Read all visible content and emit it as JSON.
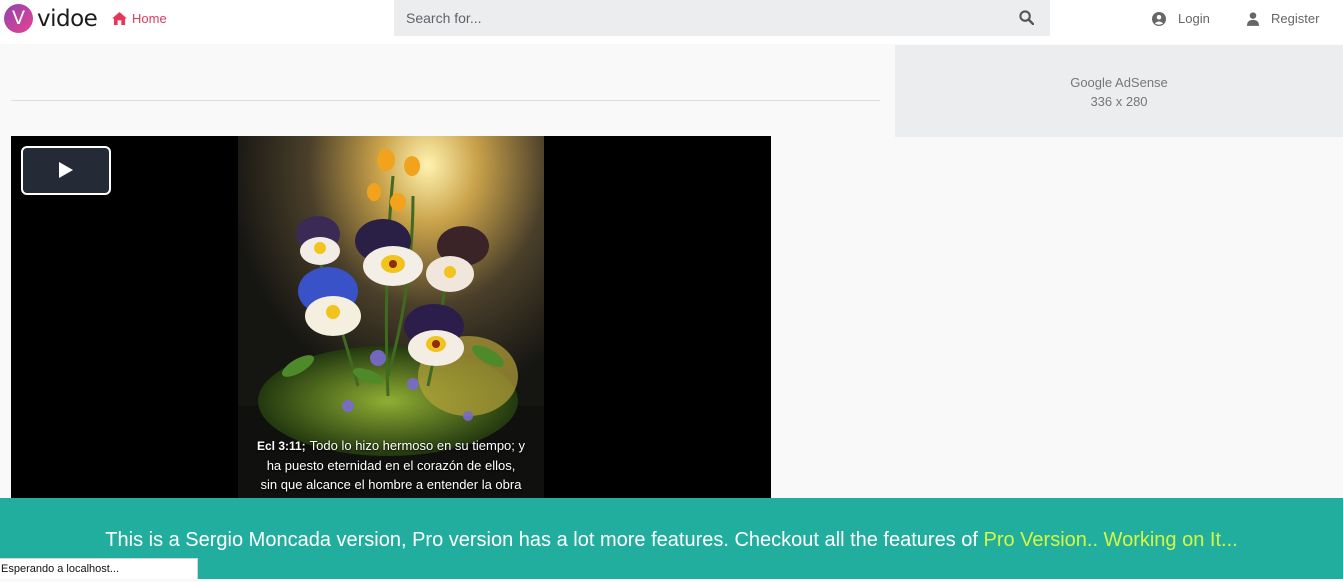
{
  "header": {
    "logo_letter": "V",
    "logo_text": "vidoe",
    "home_label": "Home",
    "search_placeholder": "Search for...",
    "login_label": "Login",
    "register_label": "Register"
  },
  "video": {
    "caption_ref": "Ecl 3:11;",
    "caption_line1": "Todo lo hizo hermoso en su tiempo; y",
    "caption_line2": "ha puesto eternidad en el corazón de ellos,",
    "caption_line3": "sin que alcance el hombre a entender la obra"
  },
  "ad": {
    "title": "Google AdSense",
    "size": "336 x 280"
  },
  "banner": {
    "text": "This is a Sergio Moncada version, Pro version has a lot more features. Checkout all the features of ",
    "link": "Pro Version.. Working on It..."
  },
  "status_bar": {
    "text": "Esperando a localhost..."
  },
  "colors": {
    "accent": "#e4385a",
    "banner_bg": "#22ae9f",
    "banner_link": "#d4f742"
  }
}
